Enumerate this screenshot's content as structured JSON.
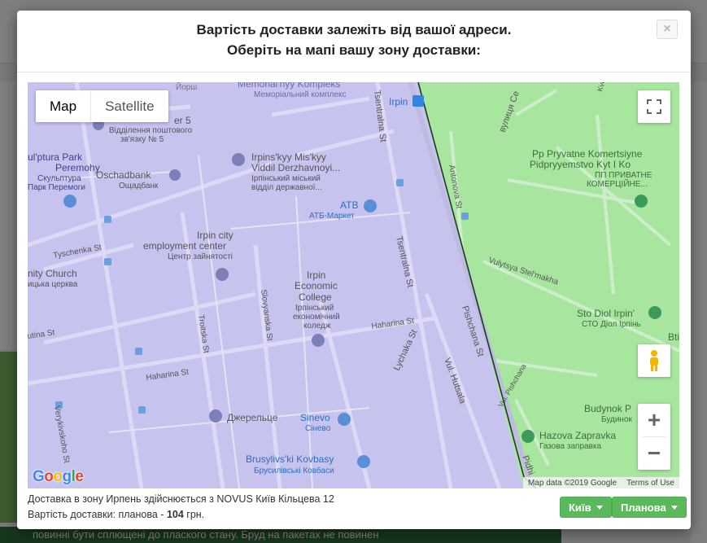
{
  "background": {
    "footer_text": "повинні бути сплющені до плаского стану. Бруд на пакетах не повинен"
  },
  "modal": {
    "title_line1": "Вартість доставки залежіть від вашої адреси.",
    "title_line2": "Оберіть на мапі вашу зону доставки:",
    "close_label": "×"
  },
  "map": {
    "type_map": "Map",
    "type_satellite": "Satellite",
    "zoom_in": "+",
    "zoom_out": "−",
    "google_letters": [
      "G",
      "o",
      "o",
      "g",
      "l",
      "e"
    ],
    "attribution_data": "Map data ©2019 Google",
    "attribution_terms": "Terms of Use",
    "labels": {
      "memorial_en": "Memorial'nyy Kompleks",
      "memorial_uk": "Меморіальний комплекс",
      "yorsh": "Йорш",
      "irpin_station": "Irpin",
      "viddilennia_top": "er 5",
      "viddilennia_uk1": "Відділення поштового",
      "viddilennia_uk2": "зв'язку № 5",
      "skulptura_en1": "ul'ptura Park",
      "skulptura_en2": "Peremohy",
      "skulptura_uk1": "Скульптура",
      "skulptura_uk2": "Парк Перемоги",
      "oschadbank_en": "Oschadbank",
      "oschadbank_uk": "Ощадбанк",
      "viddil_en1": "Irpins'kyy Mis'kyy",
      "viddil_en2": "Viddil Derzhavnoyi...",
      "viddil_uk1": "Ірпінський міський",
      "viddil_uk2": "відділ державної...",
      "atb_en": "ATB",
      "atb_uk": "АТБ-Маркет",
      "tsentralna1": "Tsentralna St",
      "tsentralna2": "Tsentralna St",
      "tyschenka": "Tyschenka St",
      "church_en": "nity Church",
      "church_uk": "ицька церква",
      "employment_en1": "Irpin city",
      "employment_en2": "employment center",
      "employment_uk": "Центр зайнятості",
      "college_en1": "Irpin",
      "college_en2": "Economic",
      "college_en3": "College",
      "college_uk1": "Ірпінський",
      "college_uk2": "економічний",
      "college_uk3": "коледж",
      "slovyanska": "Slovyanska St",
      "troitska": "Troitska St",
      "utina": "utina St",
      "haharina1": "Haharina St",
      "haharina2": "Haharina St",
      "lychaka": "Lychaka St",
      "hutsala": "Vul. Hutsala",
      "verykivskoho": "Verykivskoho St",
      "dzherelce": "Джерельце",
      "sinevo_en": "Sinevo",
      "sinevo_uk": "Сінево",
      "kovbasy_en": "Brusylivs'ki Kovbasy",
      "kovbasy_uk": "Брусилівські Ковбаси",
      "antonova": "Antonova St",
      "vulytsia_se": "вулиця Се",
      "kvitkova": "Kvitkova St",
      "pp_en1": "Pp Pryvatne Komertsiyne",
      "pp_en2": "Pidpryyemstvo Kyt I Ko",
      "pp_uk1": "ПП ПРИВАТНЕ",
      "pp_uk2": "КОМЕРЦІЙНЕ...",
      "vulytsia_stelmakha": "Vulytsya Stel'makha",
      "pishchana": "Pishchana St",
      "vul_pishchana": "Vul. Pishchana",
      "sto_en": "Sto Diol Irpin'",
      "sto_uk": "СТО Діол Ірпінь",
      "bti": "Bti",
      "budynok_en": "Budynok P",
      "budynok_uk": "Будинок",
      "hazova_en": "Hazova Zapravka",
      "hazova_uk": "Газова заправка",
      "pidhi": "Pidhi"
    }
  },
  "footer": {
    "line1": "Доставка в зону Ирпень здійснюється з NOVUS Київ Кільцева 12",
    "line2_prefix": "Вартість доставки: планова - ",
    "line2_price": "104",
    "line2_suffix": " грн.",
    "city_button": "Київ",
    "type_button": "Планова"
  },
  "colors": {
    "zone_purple": "#c6c3ee",
    "zone_green": "#a8e6a0",
    "border_line": "#1e3a1e",
    "button_green": "#5cb85c"
  }
}
